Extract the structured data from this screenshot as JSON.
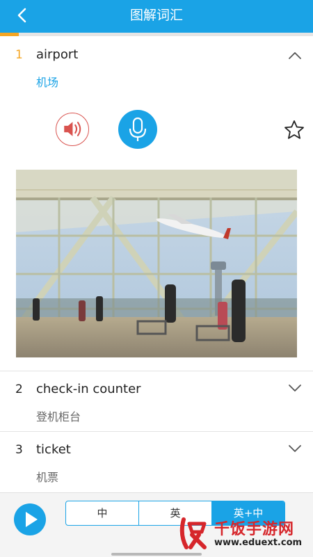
{
  "header": {
    "title": "图解词汇",
    "back_icon": "chevron-left-icon"
  },
  "progress": {
    "fraction": 0.06
  },
  "colors": {
    "accent": "#1aa3e6",
    "active_number": "#f5a623",
    "speaker_red": "#d9534f",
    "watermark_red": "#d6262b"
  },
  "items": [
    {
      "number": "1",
      "word": "airport",
      "translation": "机场",
      "expanded": true,
      "chevron_icon": "chevron-up-icon"
    },
    {
      "number": "2",
      "word": "check-in counter",
      "translation": "登机柜台",
      "expanded": false,
      "chevron_icon": "chevron-down-icon"
    },
    {
      "number": "3",
      "word": "ticket",
      "translation": "机票",
      "expanded": false,
      "chevron_icon": "chevron-down-icon"
    }
  ],
  "actions": {
    "speaker_icon": "speaker-icon",
    "mic_icon": "microphone-icon",
    "favorite_icon": "star-outline-icon"
  },
  "photo": {
    "subject": "airport-terminal-photo"
  },
  "bottom": {
    "play_icon": "play-icon",
    "modes": [
      "中",
      "英",
      "英+中"
    ],
    "selected_mode": "英+中"
  },
  "watermark": {
    "name": "千饭手游网",
    "url": "www.eduext.com"
  }
}
